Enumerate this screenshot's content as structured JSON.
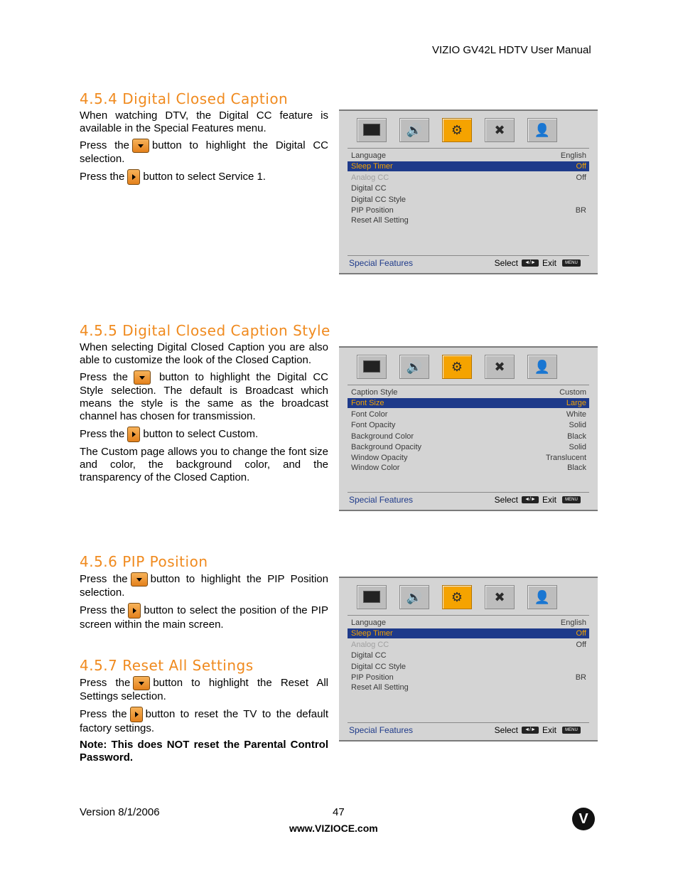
{
  "header": {
    "manual_title": "VIZIO GV42L HDTV User Manual"
  },
  "sections": [
    {
      "heading": "4.5.4 Digital Closed Caption",
      "p1": "When watching DTV, the Digital CC feature is available in the Special Features menu.",
      "p2a": "Press the",
      "p2b": "button to highlight the Digital CC selection.",
      "p3a": "Press the",
      "p3b": "button to select Service 1."
    },
    {
      "heading": "4.5.5 Digital Closed Caption Style",
      "p1": "When selecting Digital Closed Caption you are also able to customize the look of the Closed Caption.",
      "p2a": "Press the",
      "p2b": "button to highlight the Digital CC Style selection.  The default is Broadcast which means the style is the same as the broadcast channel has chosen for transmission.",
      "p3a": "Press the",
      "p3b": "button to select Custom.",
      "p4": "The Custom page allows you to change the font size and color, the background color, and the transparency of the Closed Caption."
    },
    {
      "heading": "4.5.6 PIP Position",
      "p1a": "Press the",
      "p1b": "button to highlight the PIP Position selection.",
      "p2a": "Press the",
      "p2b": "button to select the position of the PIP screen within the main screen."
    },
    {
      "heading": "4.5.7 Reset All Settings",
      "p1a": "Press the",
      "p1b": "button to highlight the Reset All Settings selection.",
      "p2a": "Press the",
      "p2b": "button to reset the TV to the default factory settings.",
      "note": "Note: This does NOT reset the Parental Control Password."
    }
  ],
  "menus": [
    {
      "header_row": {
        "label": "Language",
        "value": "English"
      },
      "rows": [
        {
          "label": "Sleep Timer",
          "value": "Off"
        },
        {
          "label": "Analog  CC",
          "value": "Off"
        },
        {
          "label": "Digital  CC",
          "value": ""
        },
        {
          "label": "Digital  CC  Style",
          "value": ""
        },
        {
          "label": "PIP  Position",
          "value": "BR"
        },
        {
          "label": "Reset All Setting",
          "value": ""
        }
      ],
      "footer": {
        "section": "Special  Features",
        "select": "Select",
        "exit": "Exit",
        "menu_key": "MENU",
        "select_key": "◄/►"
      }
    },
    {
      "header_row": {
        "label": "Caption  Style",
        "value": "Custom"
      },
      "rows": [
        {
          "label": "Font  Size",
          "value": "Large"
        },
        {
          "label": "Font  Color",
          "value": "White"
        },
        {
          "label": "Font  Opacity",
          "value": "Solid"
        },
        {
          "label": "Background  Color",
          "value": "Black"
        },
        {
          "label": "Background  Opacity",
          "value": "Solid"
        },
        {
          "label": "Window  Opacity",
          "value": "Translucent"
        },
        {
          "label": "Window  Color",
          "value": "Black"
        }
      ],
      "footer": {
        "section": "Special  Features",
        "select": "Select",
        "exit": "Exit",
        "menu_key": "MENU",
        "select_key": "◄/►"
      }
    },
    {
      "header_row": {
        "label": "Language",
        "value": "English"
      },
      "rows": [
        {
          "label": "Sleep Timer",
          "value": "Off"
        },
        {
          "label": "Analog  CC",
          "value": "Off"
        },
        {
          "label": "Digital  CC",
          "value": ""
        },
        {
          "label": "Digital  CC  Style",
          "value": ""
        },
        {
          "label": "PIP  Position",
          "value": "BR"
        },
        {
          "label": "Reset All Setting",
          "value": ""
        }
      ],
      "footer": {
        "section": "Special  Features",
        "select": "Select",
        "exit": "Exit",
        "menu_key": "MENU",
        "select_key": "◄/►"
      }
    }
  ],
  "footer": {
    "version": "Version 8/1/2006",
    "page_number": "47",
    "website": "www.VIZIOCE.com",
    "logo_letter": "V"
  }
}
